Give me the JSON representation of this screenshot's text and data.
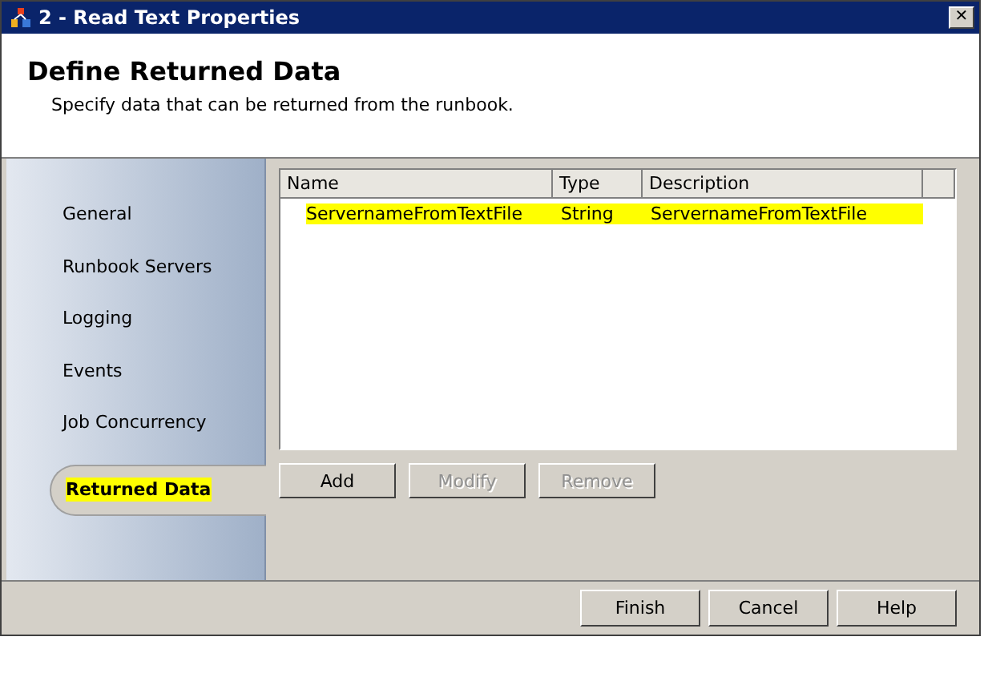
{
  "window": {
    "title": "2 - Read Text Properties",
    "close": "✕"
  },
  "header": {
    "title": "Define Returned Data",
    "subtitle": "Specify data that can be returned from the runbook."
  },
  "sidebar": {
    "items": [
      {
        "label": "General",
        "selected": false,
        "highlighted": false
      },
      {
        "label": "Runbook Servers",
        "selected": false,
        "highlighted": false
      },
      {
        "label": "Logging",
        "selected": false,
        "highlighted": false
      },
      {
        "label": "Events",
        "selected": false,
        "highlighted": false
      },
      {
        "label": "Job Concurrency",
        "selected": false,
        "highlighted": false
      },
      {
        "label": "Returned Data",
        "selected": true,
        "highlighted": true
      }
    ]
  },
  "table": {
    "columns": [
      "Name",
      "Type",
      "Description"
    ],
    "rows": [
      {
        "name": "ServernameFromTextFile",
        "type": "String",
        "description": "ServernameFromTextFile",
        "highlighted": true
      }
    ]
  },
  "table_buttons": [
    {
      "label": "Add",
      "disabled": false
    },
    {
      "label": "Modify",
      "disabled": true
    },
    {
      "label": "Remove",
      "disabled": true
    }
  ],
  "buttons": [
    {
      "label": "Finish",
      "disabled": false
    },
    {
      "label": "Cancel",
      "disabled": false
    },
    {
      "label": "Help",
      "disabled": false
    }
  ]
}
